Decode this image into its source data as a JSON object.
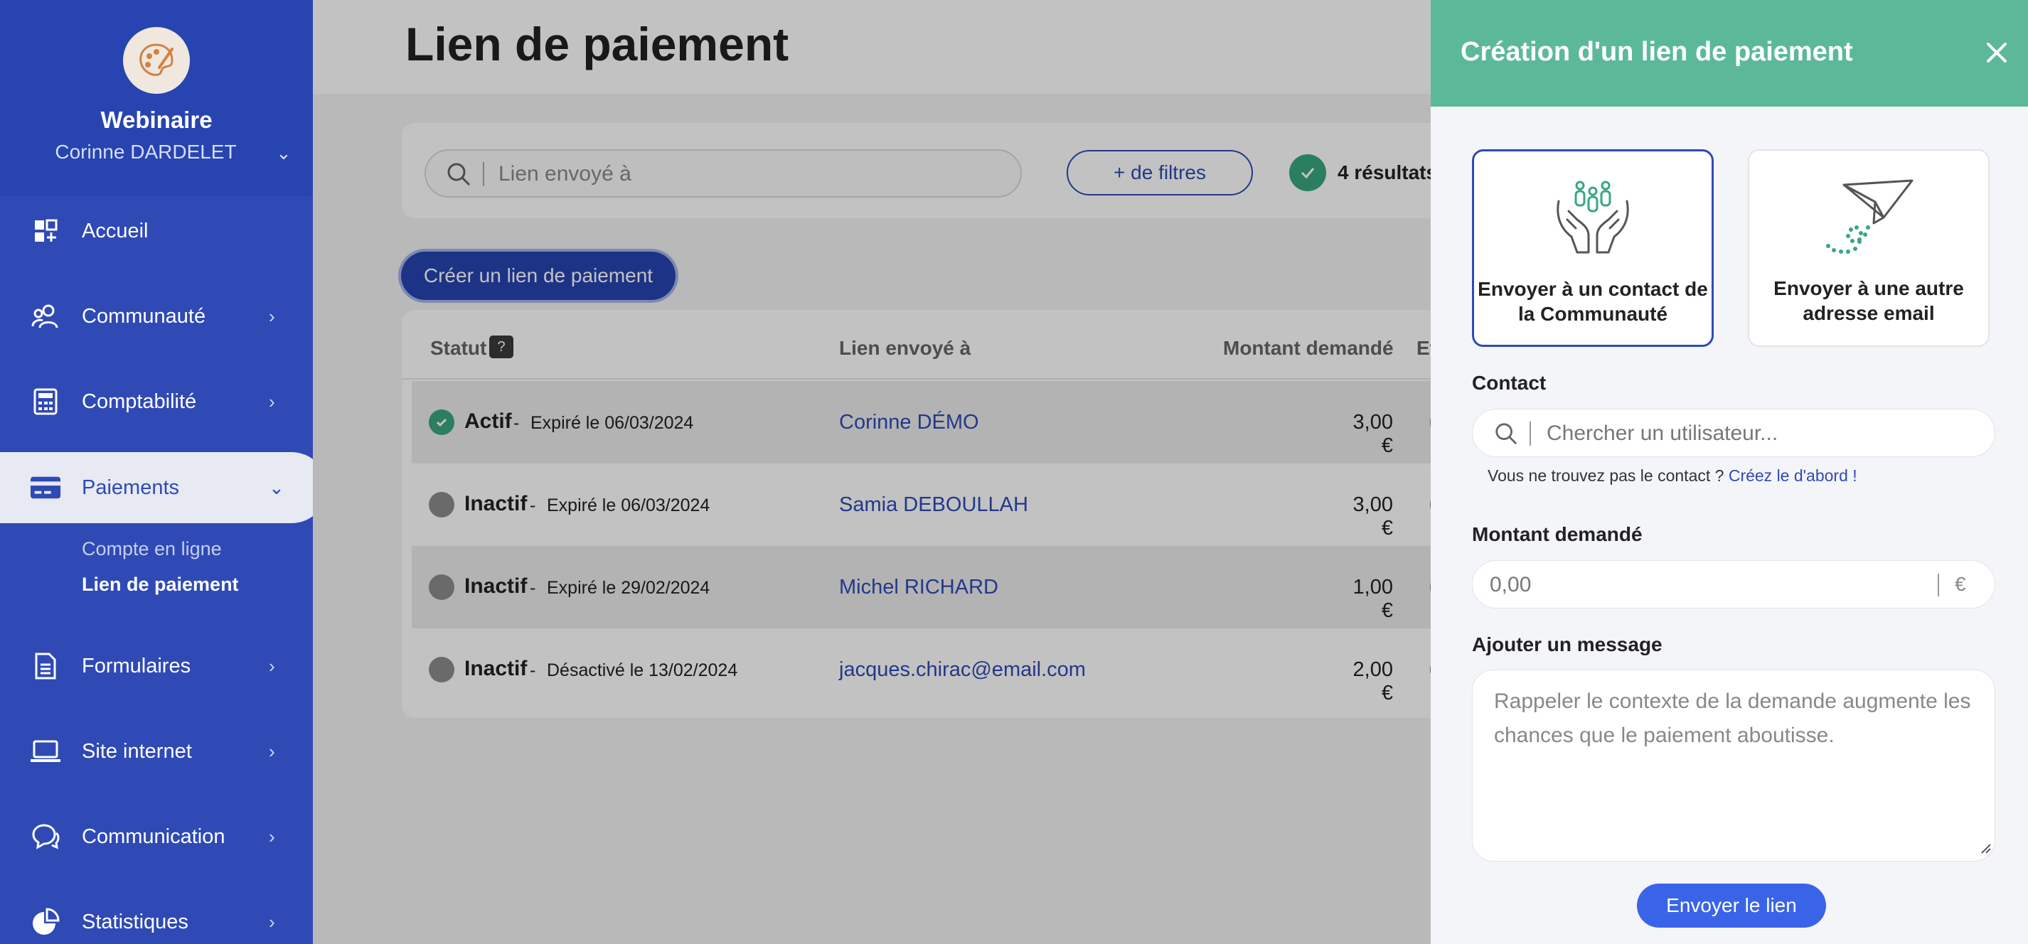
{
  "sidebar": {
    "org_name": "Webinaire",
    "user_name": "Corinne DARDELET",
    "items": [
      {
        "label": "Accueil"
      },
      {
        "label": "Communauté"
      },
      {
        "label": "Comptabilité"
      },
      {
        "label": "Paiements"
      },
      {
        "label": "Formulaires"
      },
      {
        "label": "Site internet"
      },
      {
        "label": "Communication"
      },
      {
        "label": "Statistiques"
      }
    ],
    "sub_items": [
      {
        "label": "Compte en ligne"
      },
      {
        "label": "Lien de paiement"
      }
    ]
  },
  "main": {
    "title": "Lien de paiement",
    "search_placeholder": "Lien envoyé à",
    "filters_label": "+ de filtres",
    "results_label": "4 résultats",
    "create_button": "Créer un lien de paiement",
    "table": {
      "headers": {
        "status": "Statut",
        "help": "?",
        "sent_to": "Lien envoyé à",
        "amount": "Montant demandé",
        "state": "Et"
      },
      "rows": [
        {
          "status": "Actif",
          "date": "Expiré le 06/03/2024",
          "contact": "Corinne DÉMO",
          "amount": "3,00 €"
        },
        {
          "status": "Inactif",
          "date": "Expiré le 06/03/2024",
          "contact": "Samia DEBOULLAH",
          "amount": "3,00 €"
        },
        {
          "status": "Inactif",
          "date": "Expiré le 29/02/2024",
          "contact": "Michel RICHARD",
          "amount": "1,00 €"
        },
        {
          "status": "Inactif",
          "date": "Désactivé le 13/02/2024",
          "contact": "jacques.chirac@email.com",
          "amount": "2,00 €"
        }
      ],
      "separator": "-"
    }
  },
  "drawer": {
    "title": "Création d'un lien de paiement",
    "choice_community": "Envoyer à un contact de la Communauté",
    "choice_email": "Envoyer à une autre adresse email",
    "contact_label": "Contact",
    "contact_placeholder": "Chercher un utilisateur...",
    "hint_text": "Vous ne trouvez pas le contact ?",
    "hint_link": "Créez le d'abord !",
    "amount_label": "Montant demandé",
    "amount_placeholder": "0,00",
    "currency": "€",
    "message_label": "Ajouter un message",
    "message_placeholder": "Rappeler le contexte de la demande augmente les chances que le paiement aboutisse.",
    "send_button": "Envoyer le lien"
  },
  "colors": {
    "sidebar": "#2f4ab5",
    "drawer_header": "#5bb99a",
    "primary_button": "#3a64e8",
    "status_active": "#3aa67f",
    "status_inactive": "#8c8c8c"
  },
  "icons": [
    "palette-icon",
    "dashboard-icon",
    "community-icon",
    "calculator-icon",
    "credit-card-icon",
    "document-icon",
    "laptop-icon",
    "chat-icon",
    "pie-chart-icon",
    "chevron-right-icon",
    "chevron-down-icon",
    "search-icon",
    "check-icon",
    "close-icon",
    "hands-people-icon",
    "paper-plane-icon"
  ]
}
